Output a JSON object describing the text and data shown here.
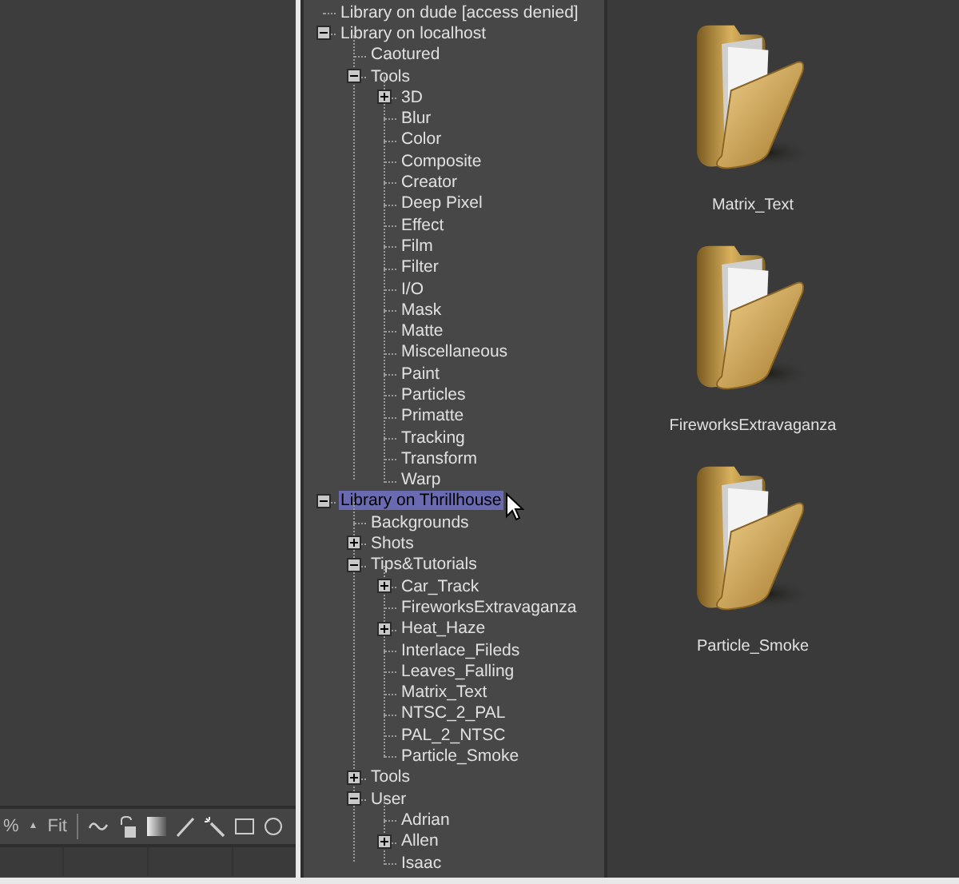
{
  "viewer_toolbar": {
    "zoom_percent": "%",
    "zoom_arrow": "▲",
    "fit": "Fit"
  },
  "tree": [
    {
      "label": "Library on dude [access denied]",
      "selected": false
    },
    {
      "label": "Library on localhost",
      "selected": false,
      "expanded": true,
      "children": [
        {
          "label": "Caotured",
          "selected": false
        },
        {
          "label": "Tools",
          "selected": false,
          "expanded": true,
          "children": [
            {
              "label": "3D",
              "selected": false,
              "expanded": false
            },
            {
              "label": "Blur",
              "selected": false
            },
            {
              "label": "Color",
              "selected": false
            },
            {
              "label": "Composite",
              "selected": false
            },
            {
              "label": "Creator",
              "selected": false
            },
            {
              "label": "Deep Pixel",
              "selected": false
            },
            {
              "label": "Effect",
              "selected": false
            },
            {
              "label": "Film",
              "selected": false
            },
            {
              "label": "Filter",
              "selected": false
            },
            {
              "label": "I/O",
              "selected": false
            },
            {
              "label": "Mask",
              "selected": false
            },
            {
              "label": "Matte",
              "selected": false
            },
            {
              "label": "Miscellaneous",
              "selected": false
            },
            {
              "label": "Paint",
              "selected": false
            },
            {
              "label": "Particles",
              "selected": false
            },
            {
              "label": "Primatte",
              "selected": false
            },
            {
              "label": "Tracking",
              "selected": false
            },
            {
              "label": "Transform",
              "selected": false
            },
            {
              "label": "Warp",
              "selected": false
            }
          ]
        }
      ]
    },
    {
      "label": "Library on Thrillhouse",
      "selected": true,
      "expanded": true,
      "children": [
        {
          "label": "Backgrounds",
          "selected": false
        },
        {
          "label": "Shots",
          "selected": false,
          "expanded": false
        },
        {
          "label": "Tips&Tutorials",
          "selected": false,
          "expanded": true,
          "children": [
            {
              "label": "Car_Track",
              "selected": false,
              "expanded": false
            },
            {
              "label": "FireworksExtravaganza",
              "selected": false
            },
            {
              "label": "Heat_Haze",
              "selected": false,
              "expanded": false
            },
            {
              "label": "Interlace_Fileds",
              "selected": false
            },
            {
              "label": "Leaves_Falling",
              "selected": false
            },
            {
              "label": "Matrix_Text",
              "selected": false
            },
            {
              "label": "NTSC_2_PAL",
              "selected": false
            },
            {
              "label": "PAL_2_NTSC",
              "selected": false
            },
            {
              "label": "Particle_Smoke",
              "selected": false
            }
          ]
        },
        {
          "label": "Tools",
          "selected": false,
          "expanded": false
        },
        {
          "label": "User",
          "selected": false,
          "expanded": true,
          "children": [
            {
              "label": "Adrian",
              "selected": false
            },
            {
              "label": "Allen",
              "selected": false,
              "expanded": false
            },
            {
              "label": "Isaac",
              "selected": false
            }
          ]
        }
      ]
    }
  ],
  "folders": [
    {
      "name": "Matrix_Text"
    },
    {
      "name": "FireworksExtravaganza"
    },
    {
      "name": "Particle_Smoke"
    }
  ]
}
